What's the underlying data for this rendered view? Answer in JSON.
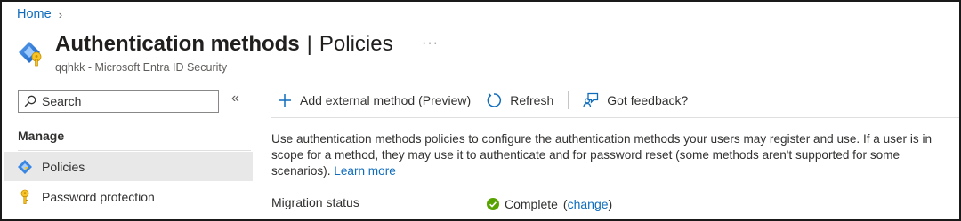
{
  "breadcrumb": {
    "home": "Home",
    "separator": "›"
  },
  "header": {
    "title": "Authentication methods",
    "divider": "|",
    "subtitle_section": "Policies",
    "more": "···",
    "tenant_line": "qqhkk - Microsoft Entra ID Security",
    "app_icon": "entra-diamond-key-icon"
  },
  "sidebar": {
    "search_placeholder": "Search",
    "collapse": "«",
    "section_label": "Manage",
    "items": [
      {
        "label": "Policies",
        "icon": "entra-diamond-icon",
        "active": true
      },
      {
        "label": "Password protection",
        "icon": "key-icon",
        "active": false
      }
    ]
  },
  "toolbar": {
    "add_label": "Add external method (Preview)",
    "refresh_label": "Refresh",
    "feedback_label": "Got feedback?"
  },
  "content": {
    "description": "Use authentication methods policies to configure the authentication methods your users may register and use. If a user is in scope for a method, they may use it to authenticate and for password reset (some methods aren't supported for some scenarios).",
    "learn_more": "Learn more",
    "migration_label": "Migration status",
    "migration_value": "Complete",
    "paren_open": "(",
    "change_link": "change",
    "paren_close": ")"
  },
  "colors": {
    "link": "#0f6cbd",
    "success": "#57a300",
    "active_bg": "#e8e8e8"
  }
}
